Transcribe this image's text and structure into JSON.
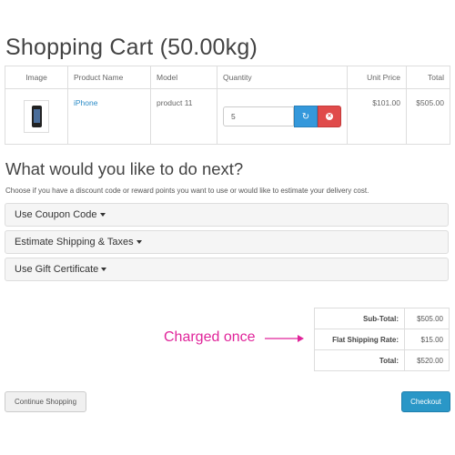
{
  "page": {
    "title": "Shopping Cart  (50.00kg)"
  },
  "cart": {
    "headers": {
      "image": "Image",
      "name": "Product Name",
      "model": "Model",
      "quantity": "Quantity",
      "unit_price": "Unit Price",
      "total": "Total"
    },
    "items": [
      {
        "name": "iPhone",
        "model": "product 11",
        "quantity": "5",
        "unit_price": "$101.00",
        "total": "$505.00",
        "image_icon": "iphone-thumbnail",
        "update_icon": "refresh-icon",
        "remove_icon": "remove-icon"
      }
    ]
  },
  "next": {
    "heading": "What would you like to do next?",
    "hint": "Choose if you have a discount code or reward points you want to use or would like to estimate your delivery cost.",
    "panels": [
      "Use Coupon Code",
      "Estimate Shipping & Taxes",
      "Use Gift Certificate"
    ]
  },
  "totals": [
    {
      "label": "Sub-Total:",
      "value": "$505.00"
    },
    {
      "label": "Flat Shipping Rate:",
      "value": "$15.00"
    },
    {
      "label": "Total:",
      "value": "$520.00"
    }
  ],
  "annotation": {
    "text": "Charged once",
    "color": "#e0249a"
  },
  "buttons": {
    "continue": "Continue Shopping",
    "checkout": "Checkout"
  },
  "colors": {
    "link": "#2a8bc7",
    "refresh": "#3498db",
    "remove": "#e04b4b",
    "checkout": "#2a97c7"
  }
}
